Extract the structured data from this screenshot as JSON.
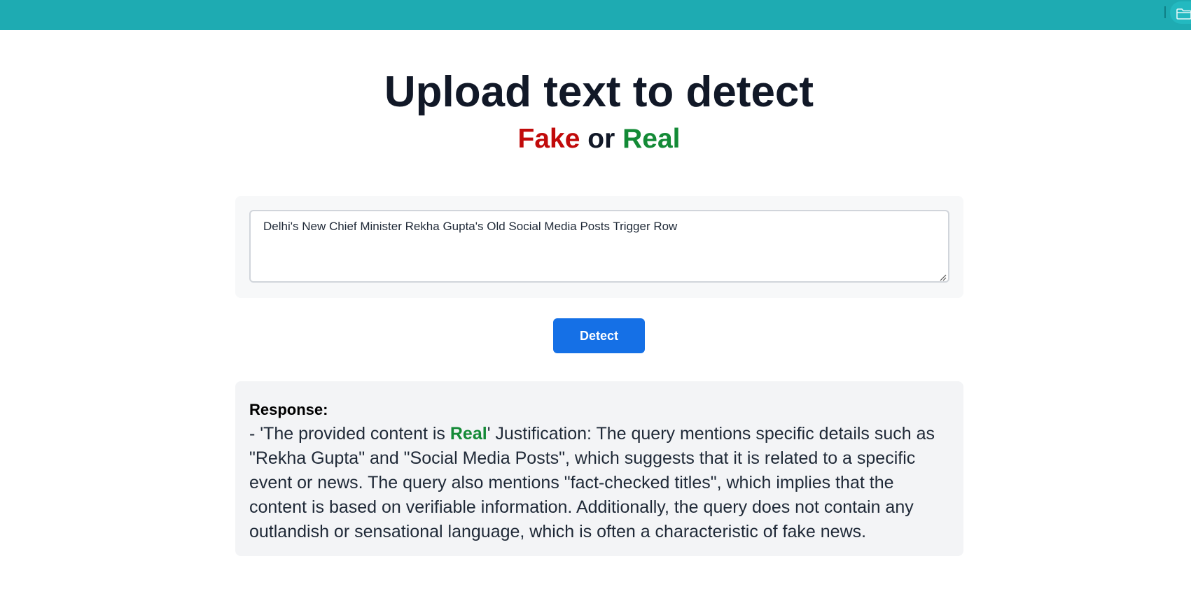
{
  "header": {
    "bar_color": "#1eabb2",
    "right_icon": "folder-icon"
  },
  "hero": {
    "title": "Upload text to detect",
    "subtitle_fake": "Fake",
    "subtitle_or": "or",
    "subtitle_real": "Real",
    "fake_color": "#c10a0a",
    "real_color": "#138a36"
  },
  "input": {
    "value": "Delhi's New Chief Minister Rekha Gupta's Old Social Media Posts Trigger Row"
  },
  "actions": {
    "detect_label": "Detect",
    "detect_color": "#1570e6"
  },
  "response": {
    "label": "Response:",
    "prefix": "- 'The provided content is ",
    "verdict": "Real",
    "body": "' Justification: The query mentions specific details such as \"Rekha Gupta\" and \"Social Media Posts\", which suggests that it is related to a specific event or news. The query also mentions \"fact-checked titles\", which implies that the content is based on verifiable information. Additionally, the query does not contain any outlandish or sensational language, which is often a characteristic of fake news."
  }
}
